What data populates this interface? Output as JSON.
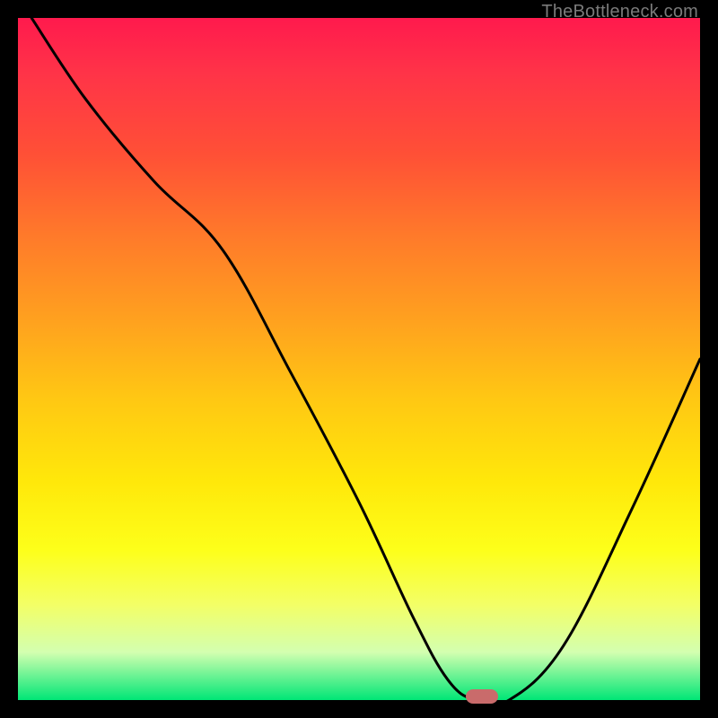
{
  "watermark": "TheBottleneck.com",
  "chart_data": {
    "type": "line",
    "title": "",
    "xlabel": "",
    "ylabel": "",
    "xlim": [
      0,
      100
    ],
    "ylim": [
      0,
      100
    ],
    "x": [
      2,
      10,
      20,
      30,
      40,
      50,
      58,
      63,
      67,
      72,
      80,
      90,
      100
    ],
    "y": [
      100,
      88,
      76,
      66,
      48,
      29,
      12,
      3,
      0,
      0,
      8,
      28,
      50
    ],
    "marker": {
      "x": 68,
      "y": 0.5
    },
    "gradient_stops": [
      {
        "pos": 0,
        "color": "#ff1a4d"
      },
      {
        "pos": 20,
        "color": "#ff5036"
      },
      {
        "pos": 44,
        "color": "#ffa01f"
      },
      {
        "pos": 68,
        "color": "#ffe80a"
      },
      {
        "pos": 86,
        "color": "#f3ff66"
      },
      {
        "pos": 100,
        "color": "#00e676"
      }
    ]
  }
}
